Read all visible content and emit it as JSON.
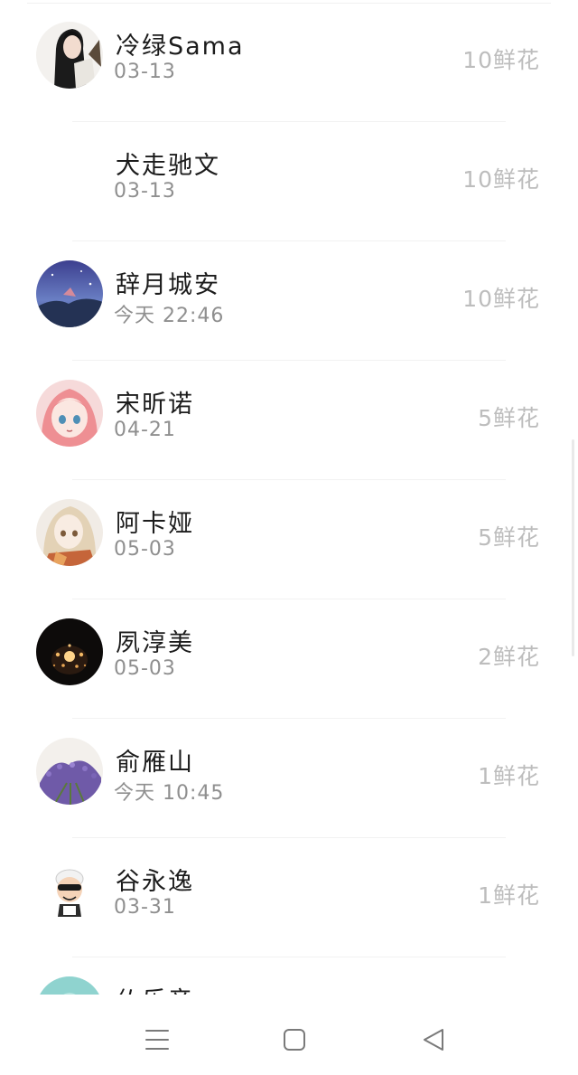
{
  "contacts": [
    {
      "name": "冷绿Sama",
      "date": "03-13",
      "flowers": "10鲜花",
      "avatar_icon": "portrait-long-hair-icon"
    },
    {
      "name": "犬走驰文",
      "date": "03-13",
      "flowers": "10鲜花",
      "avatar_icon": "blank-avatar-icon"
    },
    {
      "name": "辞月城安",
      "date": "今天 22:46",
      "flowers": "10鲜花",
      "avatar_icon": "night-sky-landscape-icon"
    },
    {
      "name": "宋昕诺",
      "date": "04-21",
      "flowers": "5鲜花",
      "avatar_icon": "pink-hair-anime-girl-icon"
    },
    {
      "name": "阿卡娅",
      "date": "05-03",
      "flowers": "5鲜花",
      "avatar_icon": "blonde-anime-girl-icon"
    },
    {
      "name": "夙淳美",
      "date": "05-03",
      "flowers": "2鲜花",
      "avatar_icon": "star-lantern-icon"
    },
    {
      "name": "俞雁山",
      "date": "今天 10:45",
      "flowers": "1鲜花",
      "avatar_icon": "lavender-flowers-icon"
    },
    {
      "name": "谷永逸",
      "date": "03-31",
      "flowers": "1鲜花",
      "avatar_icon": "cartoon-boy-sunglasses-icon"
    },
    {
      "name": "仏乐音",
      "date": "",
      "flowers": "",
      "avatar_icon": "teal-avatar-icon"
    }
  ],
  "navbar": {
    "menu_icon": "menu-icon",
    "home_icon": "home-square-icon",
    "back_icon": "back-triangle-icon"
  }
}
